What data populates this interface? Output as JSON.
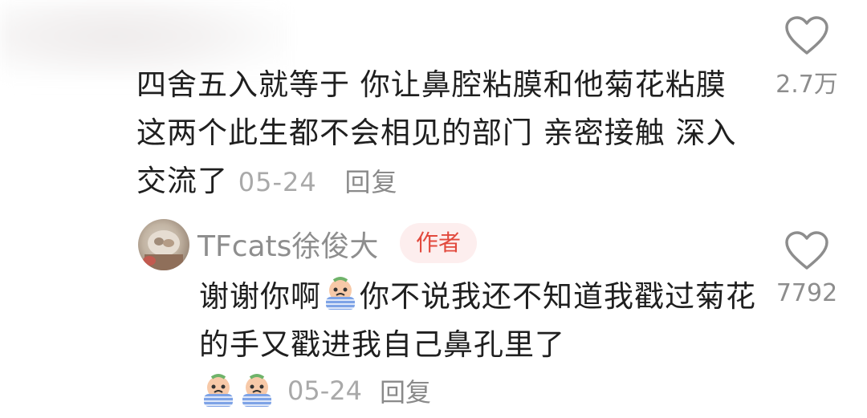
{
  "comment": {
    "text": "四舍五入就等于 你让鼻腔粘膜和他菊花粘膜 这两个此生都不会相见的部门 亲密接触 深入交流了",
    "date": "05-24",
    "reply_label": "回复",
    "like_count": "2.7万"
  },
  "reply": {
    "author": "TFcats徐俊大",
    "badge": "作者",
    "text_before_emoji": "谢谢你啊",
    "text_after_emoji": "你不说我还不知道我戳过菊花的手又戳进我自己鼻孔里了",
    "date": "05-24",
    "reply_label": "回复",
    "like_count": "7792"
  },
  "icons": {
    "like": "heart-outline-icon",
    "emoji": "crying-face-emoji"
  },
  "colors": {
    "text": "#1f1f1f",
    "meta": "#a9a9a9",
    "badge_bg": "#fdeeee",
    "badge_text": "#e2493d"
  }
}
